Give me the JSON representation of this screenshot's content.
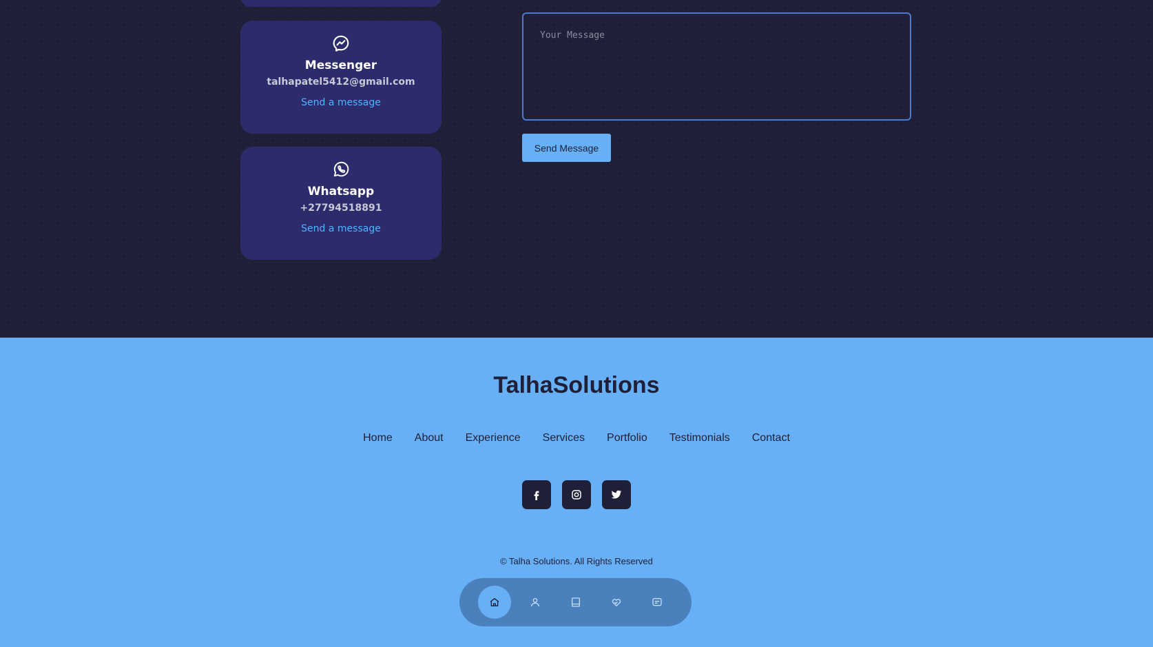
{
  "contact": {
    "messenger": {
      "title": "Messenger",
      "detail": "talhapatel5412@gmail.com",
      "link": "Send a message",
      "icon": "messenger-icon"
    },
    "whatsapp": {
      "title": "Whatsapp",
      "detail": "+27794518891",
      "link": "Send a message",
      "icon": "whatsapp-icon"
    },
    "form": {
      "message_placeholder": "Your Message",
      "message_value": "",
      "submit_label": "Send Message"
    }
  },
  "footer": {
    "logo": "TalhaSolutions",
    "nav": [
      "Home",
      "About",
      "Experience",
      "Services",
      "Portfolio",
      "Testimonials",
      "Contact"
    ],
    "socials": [
      "facebook-icon",
      "instagram-icon",
      "twitter-icon"
    ],
    "copyright": "© Talha Solutions. All Rights Reserved"
  },
  "bottom_nav": {
    "items": [
      "home-icon",
      "user-icon",
      "book-icon",
      "handshake-icon",
      "chat-icon"
    ],
    "active": "home-icon"
  },
  "colors": {
    "bg_dark": "#1f1f38",
    "card": "#2c2c6c",
    "accent": "#67b0f5",
    "link": "#4db5ff"
  }
}
